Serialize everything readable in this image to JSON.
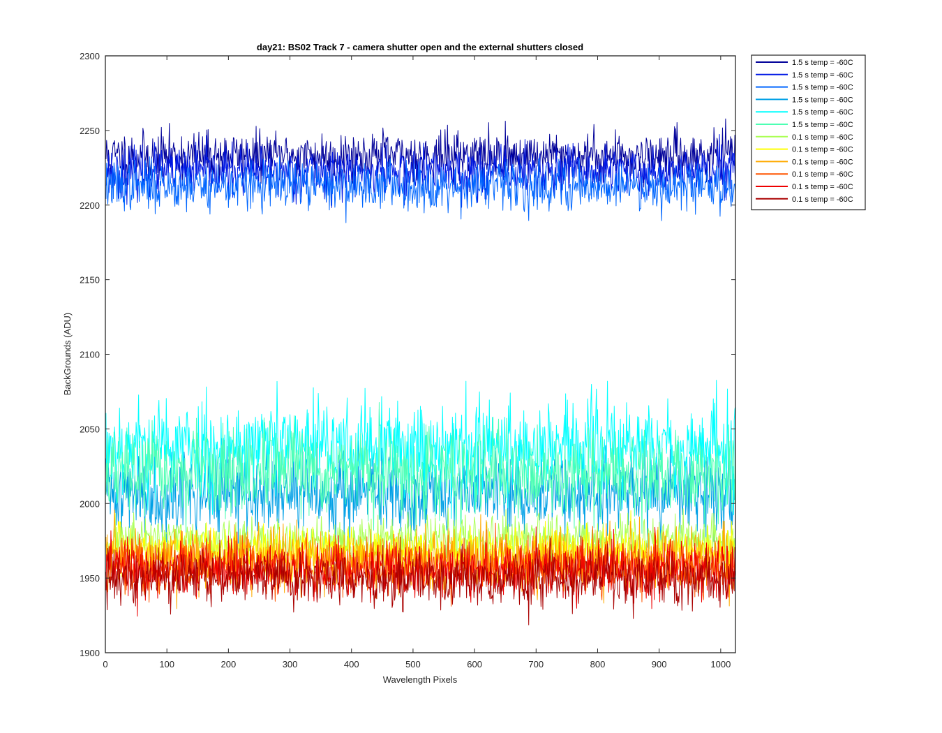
{
  "chart_data": {
    "type": "line",
    "title": "day21: BS02  Track 7 - camera shutter open and the external shutters closed",
    "xlabel": "Wavelength Pixels",
    "ylabel": "BackGrounds (ADU)",
    "xlim": [
      0,
      1024
    ],
    "ylim": [
      1900,
      2300
    ],
    "xticks": [
      0,
      100,
      200,
      300,
      400,
      500,
      600,
      700,
      800,
      900,
      1000
    ],
    "yticks": [
      1900,
      1950,
      2000,
      2050,
      2100,
      2150,
      2200,
      2250,
      2300
    ],
    "grid": false,
    "legend_position": "outside-top-right",
    "n_points": 1024,
    "series": [
      {
        "name": "1.5 s temp = -60C",
        "color": "#000099",
        "mean": 2233,
        "noise": 8,
        "seed": 11
      },
      {
        "name": "1.5 s temp = -60C",
        "color": "#0019e6",
        "mean": 2222,
        "noise": 8,
        "seed": 23
      },
      {
        "name": "1.5 s temp = -60C",
        "color": "#0066ff",
        "mean": 2213,
        "noise": 8,
        "seed": 37
      },
      {
        "name": "1.5 s temp = -60C",
        "color": "#00a0e6",
        "mean": 2007,
        "noise": 14,
        "seed": 41
      },
      {
        "name": "1.5 s temp = -60C",
        "color": "#00ffff",
        "mean": 2038,
        "noise": 16,
        "seed": 53
      },
      {
        "name": "1.5 s temp = -60C",
        "color": "#4dffb3",
        "mean": 2020,
        "noise": 14,
        "seed": 67
      },
      {
        "name": "0.1 s temp = -60C",
        "color": "#aaff55",
        "mean": 1975,
        "noise": 8,
        "seed": 71
      },
      {
        "name": "0.1 s temp = -60C",
        "color": "#ffff00",
        "mean": 1968,
        "noise": 8,
        "seed": 83
      },
      {
        "name": "0.1 s temp = -60C",
        "color": "#ffaa00",
        "mean": 1962,
        "noise": 11,
        "seed": 97
      },
      {
        "name": "0.1 s temp = -60C",
        "color": "#ff5500",
        "mean": 1958,
        "noise": 9,
        "seed": 103
      },
      {
        "name": "0.1 s temp = -60C",
        "color": "#ee0000",
        "mean": 1956,
        "noise": 9,
        "seed": 113
      },
      {
        "name": "0.1 s temp = -60C",
        "color": "#aa0000",
        "mean": 1950,
        "noise": 9,
        "seed": 127
      }
    ]
  }
}
